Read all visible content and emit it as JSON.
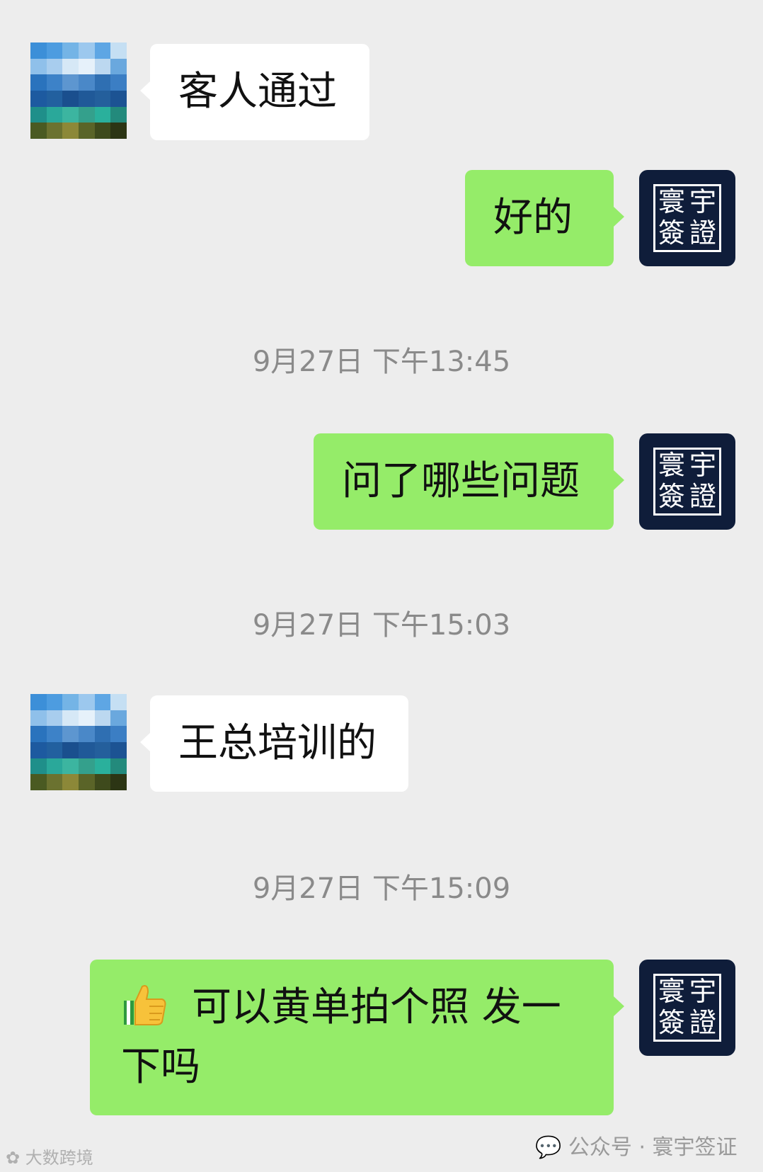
{
  "messages": [
    {
      "side": "left",
      "text": "客人通过"
    },
    {
      "side": "right",
      "text": "好的"
    },
    {
      "side": "right",
      "text": "问了哪些问题",
      "timestamp": "9月27日 下午13:45"
    },
    {
      "side": "left",
      "text": "王总培训的",
      "timestamp": "9月27日 下午15:03"
    },
    {
      "side": "right",
      "emoji": "thumbs-up",
      "text": "可以黄单拍个照  发一下吗",
      "timestamp": "9月27日 下午15:09"
    }
  ],
  "brand_avatar": {
    "chars": [
      "寰",
      "宇",
      "簽",
      "證"
    ],
    "background": "#0f1d3a",
    "foreground": "#ffffff"
  },
  "colors": {
    "background": "#ededed",
    "bubble_self": "#95ec69",
    "bubble_other": "#ffffff",
    "timestamp": "#8a8a8a"
  },
  "footer": {
    "left_watermark": "大数跨境",
    "right_watermark": "公众号 · 寰宇签证"
  }
}
